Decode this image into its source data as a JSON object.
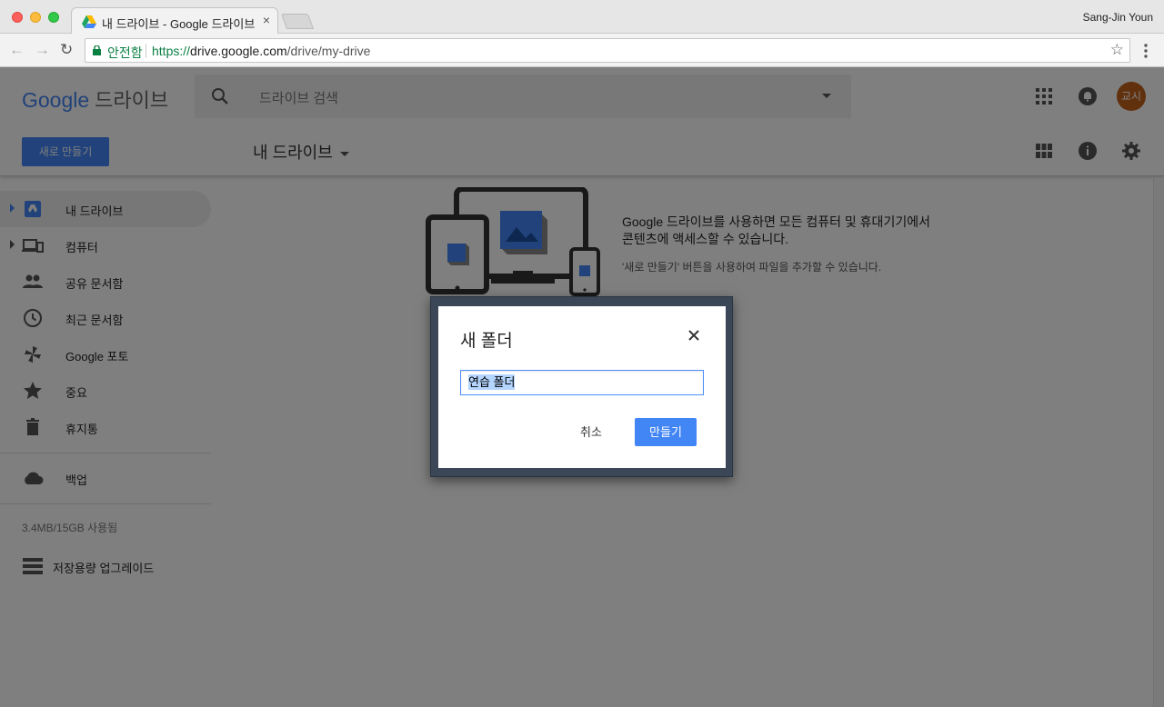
{
  "browser": {
    "tab_title": "내 드라이브 - Google 드라이브",
    "tab_close": "×",
    "profile_name": "Sang-Jin Youn",
    "secure_label": "안전함",
    "url_scheme": "https://",
    "url_host": "drive.google.com",
    "url_path": "/drive/my-drive",
    "star": "☆",
    "back": "←",
    "forward": "→",
    "reload": "↻"
  },
  "header": {
    "logo_google": "Google",
    "logo_product": "드라이브",
    "search_placeholder": "드라이브 검색",
    "avatar_text": "교시",
    "new_button": "새로 만들기",
    "location_title": "내 드라이브"
  },
  "sidebar": {
    "items": [
      {
        "label": "내 드라이브",
        "icon": "drive-icon",
        "active": true,
        "expandable": true
      },
      {
        "label": "컴퓨터",
        "icon": "computer-icon",
        "expandable": true
      },
      {
        "label": "공유 문서함",
        "icon": "people-icon"
      },
      {
        "label": "최근 문서함",
        "icon": "clock-icon"
      },
      {
        "label": "Google 포토",
        "icon": "pinwheel-icon"
      },
      {
        "label": "중요",
        "icon": "star-icon"
      },
      {
        "label": "휴지통",
        "icon": "trash-icon"
      },
      {
        "label": "백업",
        "icon": "cloud-icon"
      }
    ],
    "quota": "3.4MB/15GB 사용됨",
    "upgrade": "저장용량 업그레이드"
  },
  "empty_state": {
    "title": "Google 드라이브를 사용하면 모든 컴퓨터 및 휴대기기에서 콘텐츠에 액세스할 수 있습니다.",
    "subtitle": "'새로 만들기' 버튼을 사용하여 파일을 추가할 수 있습니다."
  },
  "dialog": {
    "title": "새 폴더",
    "input_value": "연습 폴더",
    "cancel": "취소",
    "create": "만들기"
  },
  "colors": {
    "accent": "#4285f4",
    "secure_green": "#0b8043",
    "avatar_bg": "#c2601a"
  }
}
